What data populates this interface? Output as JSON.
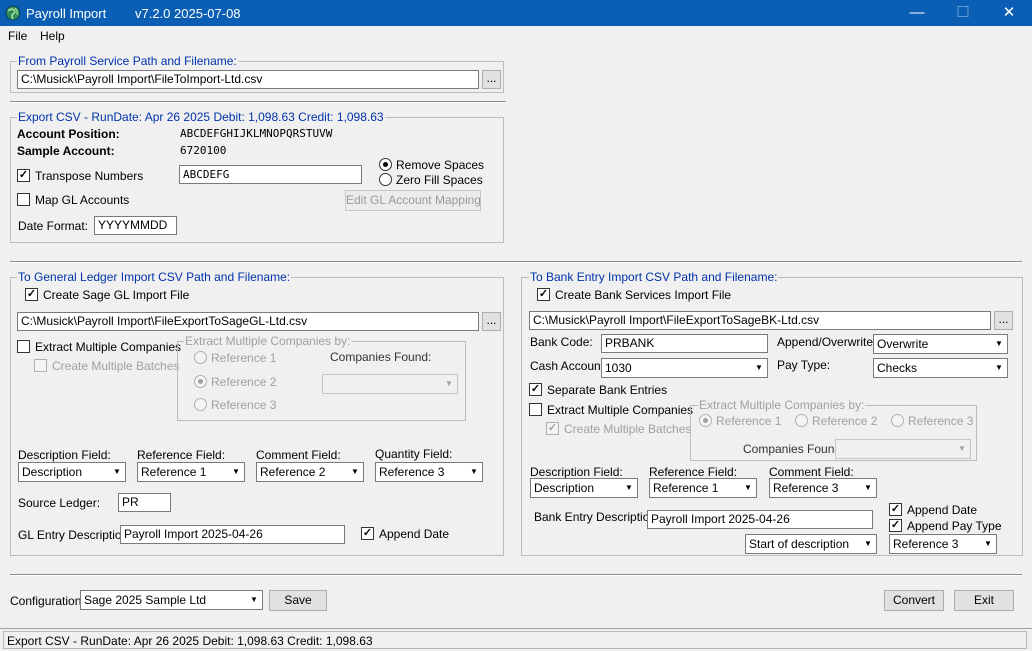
{
  "window": {
    "title": "Payroll Import",
    "version": "v7.2.0  2025-07-08",
    "minimize_icon": "minimize-icon",
    "maximize_icon": "maximize-icon",
    "close_icon": "close-icon"
  },
  "menu": {
    "file": "File",
    "help": "Help"
  },
  "source": {
    "group_title": "From Payroll Service Path and Filename:",
    "path": "C:\\Musick\\Payroll Import\\FileToImport-Ltd.csv",
    "browse": "..."
  },
  "export": {
    "group_title": "Export CSV - RunDate: Apr 26 2025   Debit: 1,098.63   Credit: 1,098.63",
    "account_position_label": "Account Position:",
    "account_position_value": "ABCDEFGHIJKLMNOPQRSTUVW",
    "sample_account_label": "Sample Account:",
    "sample_account_value": "6720100",
    "transpose_label": "Transpose Numbers",
    "transpose_value": "ABCDEFG",
    "remove_spaces": "Remove Spaces",
    "zero_fill": "Zero Fill Spaces",
    "map_gl_label": "Map GL Accounts",
    "edit_gl_button": "Edit GL Account Mapping",
    "date_format_label": "Date Format:",
    "date_format_value": "YYYYMMDD"
  },
  "gl": {
    "group_title": "To General Ledger Import CSV Path and Filename:",
    "create_label": "Create Sage GL Import File",
    "path": "C:\\Musick\\Payroll Import\\FileExportToSageGL-Ltd.csv",
    "browse": "...",
    "extract_multi": "Extract Multiple Companies",
    "create_batches": "Create Multiple Batches",
    "extract_by_title": "Extract Multiple Companies by:",
    "ref1": "Reference 1",
    "ref2": "Reference 2",
    "ref3": "Reference 3",
    "companies_found": "Companies Found:",
    "description_field_label": "Description Field:",
    "description_field_value": "Description",
    "reference_field_label": "Reference Field:",
    "reference_field_value": "Reference 1",
    "comment_field_label": "Comment Field:",
    "comment_field_value": "Reference 2",
    "quantity_field_label": "Quantity Field:",
    "quantity_field_value": "Reference 3",
    "source_ledger_label": "Source Ledger:",
    "source_ledger_value": "PR",
    "entry_desc_label": "GL Entry Description",
    "entry_desc_value": "Payroll Import 2025-04-26",
    "append_date": "Append Date"
  },
  "bank": {
    "group_title": "To Bank Entry Import CSV Path and Filename:",
    "create_label": "Create Bank Services Import File",
    "path": "C:\\Musick\\Payroll Import\\FileExportToSageBK-Ltd.csv",
    "browse": "...",
    "bank_code_label": "Bank Code:",
    "bank_code_value": "PRBANK",
    "append_overwrite_label": "Append/Overwrite:",
    "append_overwrite_value": "Overwrite",
    "cash_account_label": "Cash Account:",
    "cash_account_value": "1030",
    "pay_type_label": "Pay Type:",
    "pay_type_value": "Checks",
    "separate_entries": "Separate Bank Entries",
    "extract_multi": "Extract Multiple Companies",
    "create_batches": "Create Multiple Batches",
    "extract_by_title": "Extract Multiple Companies by:",
    "ref1": "Reference 1",
    "ref2": "Reference 2",
    "ref3": "Reference 3",
    "companies_found": "Companies Found:",
    "description_field_label": "Description Field:",
    "description_field_value": "Description",
    "reference_field_label": "Reference Field:",
    "reference_field_value": "Reference 1",
    "comment_field_label": "Comment Field:",
    "comment_field_value": "Reference 3",
    "entry_desc_label": "Bank Entry Description",
    "entry_desc_value": "Payroll Import 2025-04-26",
    "append_date": "Append Date",
    "append_pay_type": "Append Pay Type",
    "position_value": "Start of description",
    "append_ref_value": "Reference 3"
  },
  "footer": {
    "configuration_label": "Configuration:",
    "configuration_value": "Sage 2025 Sample Ltd",
    "save": "Save",
    "convert": "Convert",
    "exit": "Exit"
  },
  "status": {
    "text": "Export CSV - RunDate: Apr 26 2025   Debit: 1,098.63   Credit: 1,098.63"
  },
  "colors": {
    "titlebar": "#0a5fb4",
    "group_title": "#0033aa",
    "background": "#f0f0f0"
  }
}
